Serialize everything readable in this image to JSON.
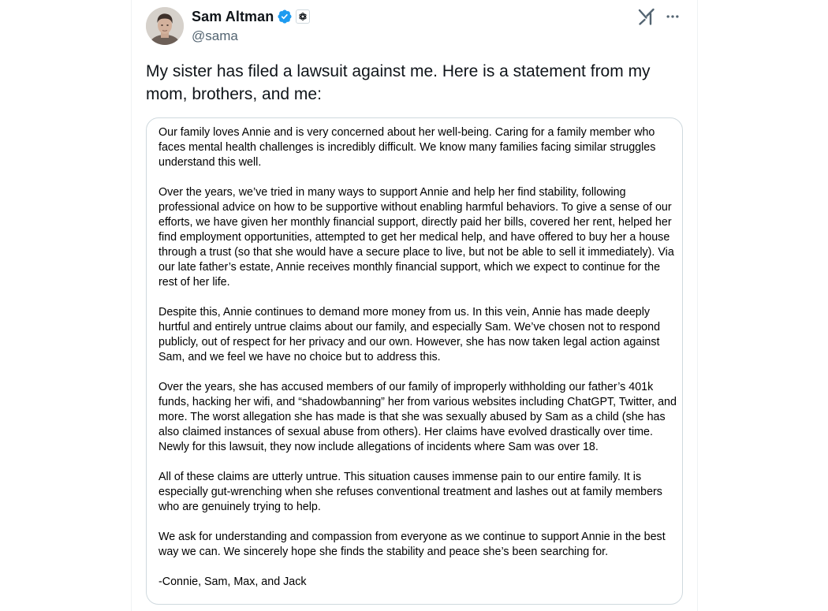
{
  "author": {
    "name": "Sam Altman",
    "handle": "@sama"
  },
  "icons": {
    "verified": "verified-badge-icon",
    "affiliation": "openai-logo-icon",
    "grok": "grok-icon",
    "more": "more-options-icon"
  },
  "colors": {
    "verified_blue": "#1d9bf0",
    "secondary_text": "#536471",
    "border": "#cfd9de"
  },
  "tweet": {
    "text": "My sister has filed a lawsuit against me. Here is a statement from my\nmom, brothers, and me:"
  },
  "statement": {
    "paragraphs": [
      "Our family loves Annie and is very concerned about her well-being. Caring for a family member who faces mental health challenges is incredibly difficult. We know many families facing similar struggles understand this well.",
      "Over the years, we’ve tried in many ways to support Annie and help her find stability, following professional advice on how to be supportive without enabling harmful behaviors. To give a sense of our efforts, we have given her monthly financial support, directly paid her bills, covered her rent, helped her find employment opportunities, attempted to get her medical help, and have offered to buy her a house through a trust (so that she would have a secure place to live, but not be able to sell it immediately). Via our late father’s estate, Annie receives monthly financial support, which we expect to continue for the rest of her life.",
      "Despite this, Annie continues to demand more money from us. In this vein, Annie has made deeply hurtful and entirely untrue claims about our family, and especially Sam. We’ve chosen not to respond publicly, out of respect for her privacy and our own. However, she has now taken legal action against Sam, and we feel we have no choice but to address this.",
      "Over the years, she has accused members of our family of improperly withholding our father’s 401k funds, hacking her wifi, and “shadowbanning” her from various websites including ChatGPT, Twitter, and more. The worst allegation she has made is that she was sexually abused by Sam as a child (she has also claimed instances of sexual abuse from others). Her claims have evolved drastically over time. Newly for this lawsuit, they now include allegations of incidents where Sam was over 18.",
      "All of these claims are utterly untrue. This situation causes immense pain to our entire family. It is especially gut-wrenching when she refuses conventional treatment and lashes out at family members who are genuinely trying to help.",
      "We ask for understanding and compassion from everyone as we continue to support Annie in the best way we can. We sincerely hope she finds the stability and peace she’s been searching for."
    ],
    "signature": "-Connie, Sam, Max, and Jack"
  }
}
